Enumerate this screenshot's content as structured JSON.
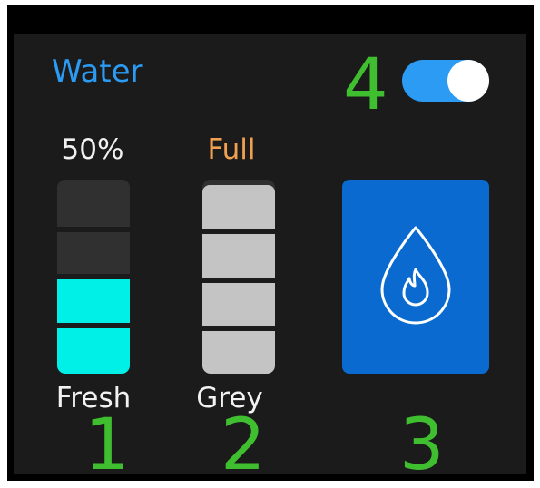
{
  "header": {
    "title": "Water",
    "toggle_on": true
  },
  "tanks": {
    "fresh": {
      "label": "Fresh",
      "value": "50%",
      "level": 0.5,
      "segments": 4
    },
    "grey": {
      "label": "Grey",
      "value": "Full",
      "level": 1.0,
      "segments": 4
    }
  },
  "heater": {
    "icon": "water-heater-icon",
    "active": true
  },
  "annotations": [
    "1",
    "2",
    "3",
    "4"
  ],
  "colors": {
    "accent": "#2b9bf4",
    "fresh_fill": "#00f0e8",
    "grey_fill": "#c4c4c4",
    "grey_value": "#f0a050",
    "heater_bg": "#0a6ad0",
    "annotation": "#3fbf2f"
  }
}
